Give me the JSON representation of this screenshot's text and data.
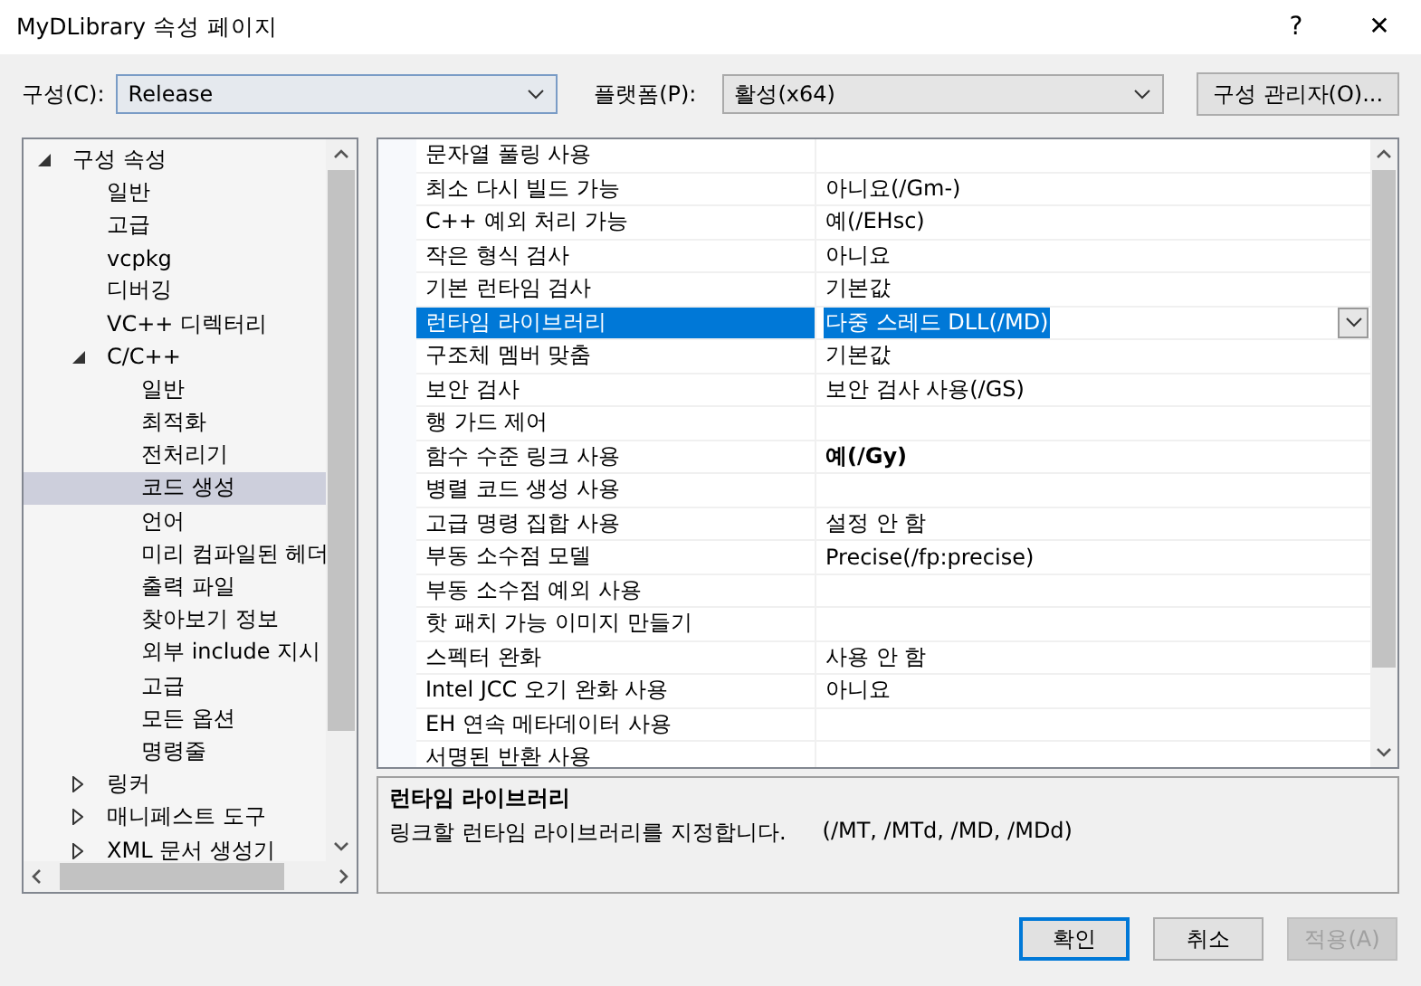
{
  "window": {
    "title": "MyDLibrary 속성 페이지",
    "help": "?",
    "close": "✕"
  },
  "toolbar": {
    "config_label": "구성(C):",
    "config_value": "Release",
    "platform_label": "플랫폼(P):",
    "platform_value": "활성(x64)",
    "manager_button": "구성 관리자(O)..."
  },
  "tree": [
    {
      "label": "구성 속성",
      "expanded": true,
      "selected": false,
      "children": [
        {
          "label": "일반",
          "selected": false
        },
        {
          "label": "고급",
          "selected": false
        },
        {
          "label": "vcpkg",
          "selected": false
        },
        {
          "label": "디버깅",
          "selected": false
        },
        {
          "label": "VC++ 디렉터리",
          "selected": false
        },
        {
          "label": "C/C++",
          "expanded": true,
          "selected": false,
          "children": [
            {
              "label": "일반",
              "selected": false
            },
            {
              "label": "최적화",
              "selected": false
            },
            {
              "label": "전처리기",
              "selected": false
            },
            {
              "label": "코드 생성",
              "selected": true
            },
            {
              "label": "언어",
              "selected": false
            },
            {
              "label": "미리 컴파일된 헤더",
              "selected": false
            },
            {
              "label": "출력 파일",
              "selected": false
            },
            {
              "label": "찾아보기 정보",
              "selected": false
            },
            {
              "label": "외부 include 지시",
              "selected": false
            },
            {
              "label": "고급",
              "selected": false
            },
            {
              "label": "모든 옵션",
              "selected": false
            },
            {
              "label": "명령줄",
              "selected": false
            }
          ]
        },
        {
          "label": "링커",
          "expanded": false,
          "selected": false
        },
        {
          "label": "매니페스트 도구",
          "expanded": false,
          "selected": false
        },
        {
          "label": "XML 문서 생성기",
          "expanded": false,
          "selected": false
        }
      ]
    }
  ],
  "grid": [
    {
      "name": "문자열 풀링 사용",
      "selected": false
    },
    {
      "name": "최소 다시 빌드 가능",
      "value": "아니요(/Gm-)",
      "bold": false,
      "selected": false
    },
    {
      "name": "C++ 예외 처리 가능",
      "value": "예(/EHsc)",
      "bold": false,
      "selected": false
    },
    {
      "name": "작은 형식 검사",
      "value": "아니요",
      "bold": false,
      "selected": false
    },
    {
      "name": "기본 런타임 검사",
      "value": "기본값",
      "bold": false,
      "selected": false
    },
    {
      "name": "런타임 라이브러리",
      "value": "다중 스레드 DLL(/MD)",
      "bold": false,
      "selected": true
    },
    {
      "name": "구조체 멤버 맞춤",
      "value": "기본값",
      "bold": false,
      "selected": false
    },
    {
      "name": "보안 검사",
      "value": "보안 검사 사용(/GS)",
      "bold": false,
      "selected": false
    },
    {
      "name": "행 가드 제어",
      "selected": false
    },
    {
      "name": "함수 수준 링크 사용",
      "value": "예(/Gy)",
      "bold": true,
      "selected": false
    },
    {
      "name": "병렬 코드 생성 사용",
      "selected": false
    },
    {
      "name": "고급 명령 집합 사용",
      "value": "설정 안 함",
      "bold": false,
      "selected": false
    },
    {
      "name": "부동 소수점 모델",
      "value": "Precise(/fp:precise)",
      "bold": false,
      "selected": false
    },
    {
      "name": "부동 소수점 예외 사용",
      "selected": false
    },
    {
      "name": "핫 패치 가능 이미지 만들기",
      "selected": false
    },
    {
      "name": "스펙터 완화",
      "value": "사용 안 함",
      "bold": false,
      "selected": false
    },
    {
      "name": "Intel JCC 오기 완화 사용",
      "value": "아니요",
      "bold": false,
      "selected": false
    },
    {
      "name": "EH 연속 메타데이터 사용",
      "selected": false
    },
    {
      "name": "서명된 반환 사용",
      "selected": false
    }
  ],
  "description": {
    "title": "런타임 라이브러리",
    "text": "링크할 런타임 라이브러리를 지정합니다.",
    "flags": "(/MT, /MTd, /MD, /MDd)"
  },
  "buttons": [
    {
      "label": "확인",
      "default": true,
      "disabled": false
    },
    {
      "label": "취소",
      "default": false,
      "disabled": false
    },
    {
      "label": "적용(A)",
      "default": false,
      "disabled": true
    }
  ]
}
